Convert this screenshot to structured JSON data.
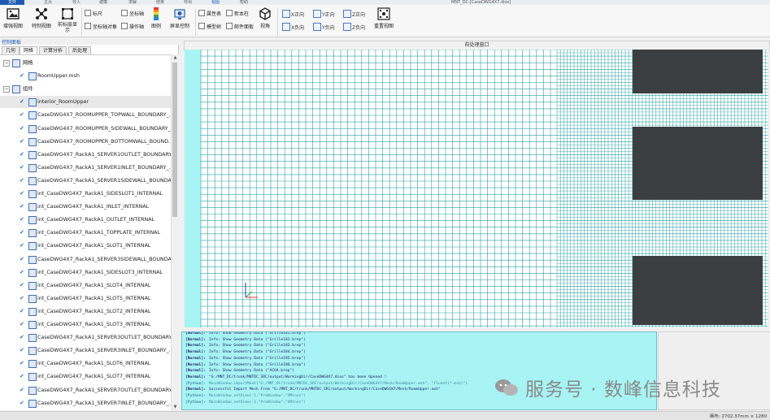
{
  "menubar": {
    "file": "文件",
    "items": [
      "主页",
      "导入",
      "建模",
      "求解",
      "结果",
      "导出",
      "视图",
      "帮助"
    ],
    "window_title": "MNT_DC-[CaseDWG4X7.dios]"
  },
  "ribbon": {
    "buttons": [
      "增强视图",
      "特制视图",
      "前标层显示",
      "图例",
      "屏显控制",
      "视角",
      "重置视图"
    ],
    "checks": [
      "标尺",
      "坐标轴",
      "属性表",
      "新本柱",
      "坐标轴对象",
      "操作轴",
      "模型树",
      "邮件面板"
    ],
    "axes": [
      "X正向",
      "Y正向",
      "Z正向",
      "X负向",
      "Y负向",
      "Z负向"
    ]
  },
  "panel": {
    "title": "控制面板",
    "tabs": [
      "几何",
      "网格",
      "计算分析",
      "后处理"
    ],
    "active_tab": "网格",
    "tree": [
      {
        "label": "网格",
        "level": 0,
        "toggle": "−"
      },
      {
        "label": "RoomUpper.msh",
        "level": 1
      },
      {
        "label": "组件",
        "level": 0,
        "toggle": "−"
      },
      {
        "label": "interior_RoomUpper",
        "level": 1,
        "selected": true
      },
      {
        "label": "CaseDWG4X7_ROOMUPPER_TOPWALL_BOUNDARY_...",
        "level": 1
      },
      {
        "label": "CaseDWG4X7_ROOMUPPER_SIDEWALL_BOUNDARY_...",
        "level": 1
      },
      {
        "label": "CaseDWG4X7_ROOMUPPER_BOTTOMWALL_BOUND...",
        "level": 1
      },
      {
        "label": "CaseDWG4X7_RackA1_SERVER1OUTLET_BOUNDARY...",
        "level": 1
      },
      {
        "label": "CaseDWG4X7_RackA1_SERVER1INLET_BOUNDARY_...",
        "level": 1
      },
      {
        "label": "CaseDWG4X7_RackA1_SERVER1SIDEWALL_BOUNDA...",
        "level": 1
      },
      {
        "label": "int_CaseDWG4X7_RackA1_SIDESLOT1_INTERNAL",
        "level": 1
      },
      {
        "label": "int_CaseDWG4X7_RackA1_INLET_INTERNAL",
        "level": 1
      },
      {
        "label": "int_CaseDWG4X7_RackA1_OUTLET_INTERNAL",
        "level": 1
      },
      {
        "label": "int_CaseDWG4X7_RackA1_TOPPLATE_INTERNAL",
        "level": 1
      },
      {
        "label": "int_CaseDWG4X7_RackA1_SLOT1_INTERNAL",
        "level": 1
      },
      {
        "label": "CaseDWG4X7_RackA1_SERVER3SIDEWALL_BOUNDA...",
        "level": 1
      },
      {
        "label": "int_CaseDWG4X7_RackA1_SIDESLOT3_INTERNAL",
        "level": 1
      },
      {
        "label": "int_CaseDWG4X7_RackA1_SLOT4_INTERNAL",
        "level": 1
      },
      {
        "label": "int_CaseDWG4X7_RackA1_SLOT5_INTERNAL",
        "level": 1
      },
      {
        "label": "int_CaseDWG4X7_RackA1_SLOT2_INTERNAL",
        "level": 1
      },
      {
        "label": "int_CaseDWG4X7_RackA1_SLOT3_INTERNAL",
        "level": 1
      },
      {
        "label": "CaseDWG4X7_RackA1_SERVER3OUTLET_BOUNDARY...",
        "level": 1
      },
      {
        "label": "CaseDWG4X7_RackA1_SERVER3INLET_BOUNDARY_...",
        "level": 1
      },
      {
        "label": "int_CaseDWG4X7_RackA1_SLOT6_INTERNAL",
        "level": 1
      },
      {
        "label": "int_CaseDWG4X7_RackA1_SLOT7_INTERNAL",
        "level": 1
      },
      {
        "label": "CaseDWG4X7_RackA1_SERVER7OUTLET_BOUNDARY...",
        "level": 1
      },
      {
        "label": "CaseDWG4X7_RackA1_SERVER7INLET_BOUNDARY_...",
        "level": 1
      }
    ]
  },
  "viewport": {
    "title": "前处理窗口",
    "mesh_color": "#2aa0a6",
    "block_color": "#3c3f41"
  },
  "console": {
    "lines": [
      {
        "tag": "[Normal]:",
        "text": "Info: Show Geometry Data (\"Grille181.brep\")"
      },
      {
        "tag": "[Normal]:",
        "text": "Info: Show Geometry Data (\"Grille182.brep\")"
      },
      {
        "tag": "[Normal]:",
        "text": "Info: Show Geometry Data (\"Grille183.brep\")"
      },
      {
        "tag": "[Normal]:",
        "text": "Info: Show Geometry Data (\"Grille184.brep\")"
      },
      {
        "tag": "[Normal]:",
        "text": "Info: Show Geometry Data (\"Grille185.brep\")"
      },
      {
        "tag": "[Normal]:",
        "text": "Info: Show Geometry Data (\"Grille186.brep\")"
      },
      {
        "tag": "[Normal]:",
        "text": "Info: Show Geometry Data (\"ACU4.brep\")"
      },
      {
        "tag": "[Normal]:",
        "text": "\"G:/MNT_DC/trunk/MNTDC_SRC/output/WorkingDir/CaseDWG4X7.dios\" has been Opened !"
      },
      {
        "tag": "[Python]:",
        "text": "MainWindow.importMesh(\"G:/MNT_DC/trunk/MNTDC_SRC/output/WorkingDir/CaseDWG4X7/Mesh/RoomUpper.msh\", \"Fluent(*.msh)\")",
        "py": true
      },
      {
        "tag": "[Normal]:",
        "text": "Successful Import Mesh From \"G:/MNT_DC/trunk/MNTDC_SRC/output/WorkingDir/CaseDWG4X7/Mesh/RoomUpper.msh\""
      },
      {
        "tag": "[Python]:",
        "text": "MainWindow.setView(-1,\"PreWindow\",\"XMinus\")",
        "py": true
      },
      {
        "tag": "[Python]:",
        "text": "MainWindow.setView(-1,\"PreWindow\",\"XMinus\")",
        "py": true
      }
    ]
  },
  "watermark": "服务号 · 数峰信息科技",
  "status": "画布: 2702.37mm × 1280"
}
